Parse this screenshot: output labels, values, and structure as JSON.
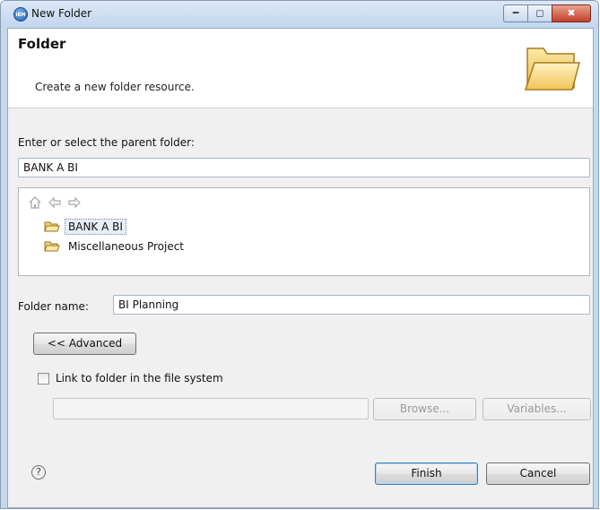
{
  "window": {
    "title": "New Folder",
    "app_icon_glyph": "IBM"
  },
  "banner": {
    "title": "Folder",
    "description": "Create a new folder resource."
  },
  "parent": {
    "label": "Enter or select the parent folder:",
    "value": "BANK A BI"
  },
  "tree": {
    "items": [
      {
        "label": "BANK A BI",
        "selected": true
      },
      {
        "label": "Miscellaneous Project",
        "selected": false
      }
    ]
  },
  "folder_name": {
    "label": "Folder name:",
    "value": "BI Planning"
  },
  "buttons": {
    "advanced": "<< Advanced",
    "browse": "Browse...",
    "variables": "Variables...",
    "finish": "Finish",
    "cancel": "Cancel"
  },
  "link": {
    "label": "Link to folder in the file system",
    "checked": false,
    "path_value": ""
  },
  "icons": {
    "home": "home-icon",
    "back": "back-arrow-icon",
    "forward": "forward-arrow-icon",
    "help": "?"
  },
  "colors": {
    "accent": "#3c7fb1",
    "titlebar": "#c3d6ee",
    "close_button": "#c2412a"
  }
}
